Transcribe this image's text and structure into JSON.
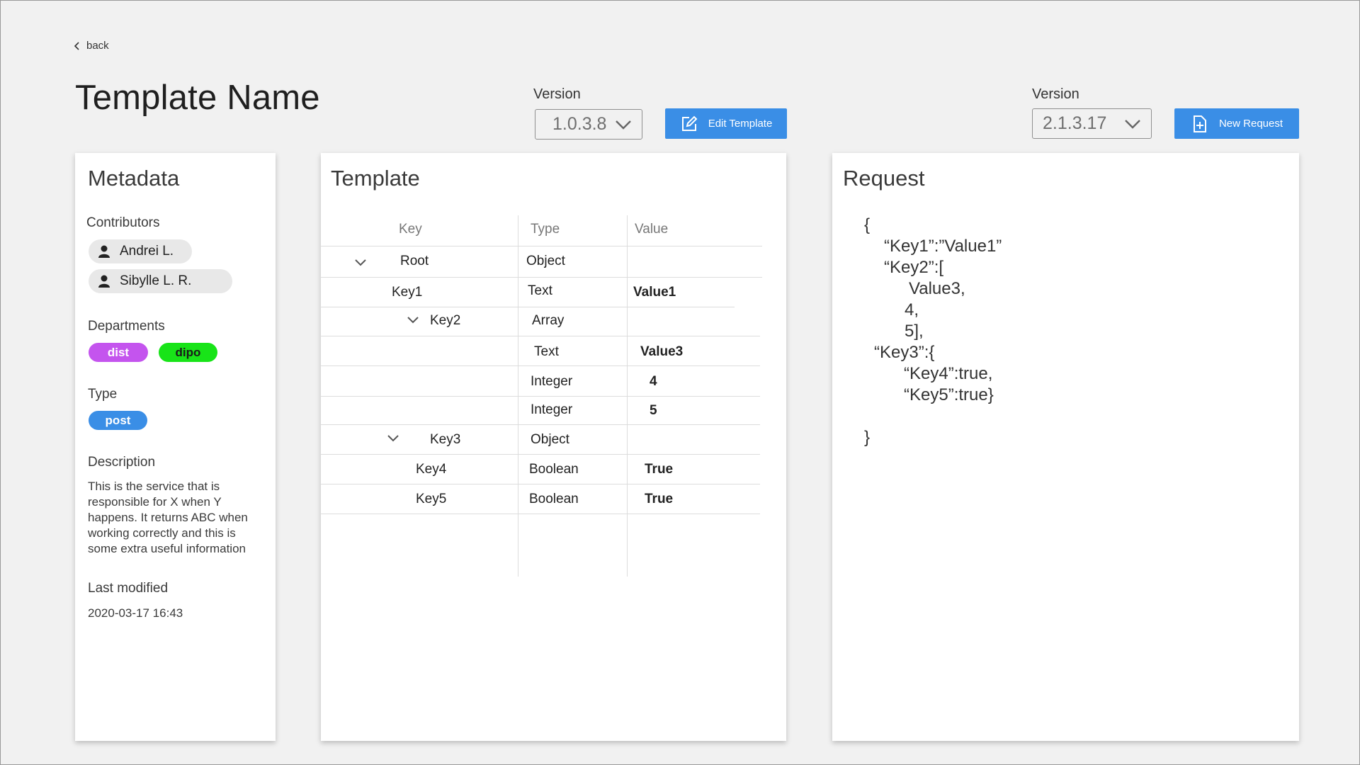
{
  "nav": {
    "back_label": "back"
  },
  "page": {
    "title": "Template Name"
  },
  "template_version": {
    "label": "Version",
    "value": "1.0.3.8",
    "edit_label": "Edit Template"
  },
  "request_version": {
    "label": "Version",
    "value": "2.1.3.17",
    "new_label": "New Request"
  },
  "metadata": {
    "title": "Metadata",
    "contributors_label": "Contributors",
    "contributors": [
      "Andrei L.",
      "Sibylle L. R."
    ],
    "departments_label": "Departments",
    "departments": [
      {
        "name": "dist",
        "color": "#c454ee",
        "text_color": "#ffffff"
      },
      {
        "name": "dipo",
        "color": "#18e418",
        "text_color": "#1a1a1a"
      }
    ],
    "type_label": "Type",
    "type": {
      "name": "post",
      "color": "#3a8ee6"
    },
    "description_label": "Description",
    "description": "This is the service that is responsible for X when Y happens. It returns ABC when working correctly and this is some extra useful information",
    "last_modified_label": "Last modified",
    "last_modified": "2020-03-17 16:43"
  },
  "template": {
    "title": "Template",
    "headers": {
      "key": "Key",
      "type": "Type",
      "value": "Value"
    },
    "rows": [
      {
        "key": "Root",
        "type": "Object",
        "value": ""
      },
      {
        "key": "Key1",
        "type": "Text",
        "value": "Value1"
      },
      {
        "key": "Key2",
        "type": "Array",
        "value": ""
      },
      {
        "key": "",
        "type": "Text",
        "value": "Value3"
      },
      {
        "key": "",
        "type": "Integer",
        "value": "4"
      },
      {
        "key": "",
        "type": "Integer",
        "value": "5"
      },
      {
        "key": "Key3",
        "type": "Object",
        "value": ""
      },
      {
        "key": "Key4",
        "type": "Boolean",
        "value": "True"
      },
      {
        "key": "Key5",
        "type": "Boolean",
        "value": "True"
      }
    ]
  },
  "request": {
    "title": "Request",
    "lines": [
      "{",
      "“Key1”:”Value1”",
      "“Key2”:[",
      "Value3,",
      "4,",
      "5],",
      "“Key3”:{",
      "“Key4”:true,",
      "“Key5”:true}",
      "}"
    ]
  }
}
